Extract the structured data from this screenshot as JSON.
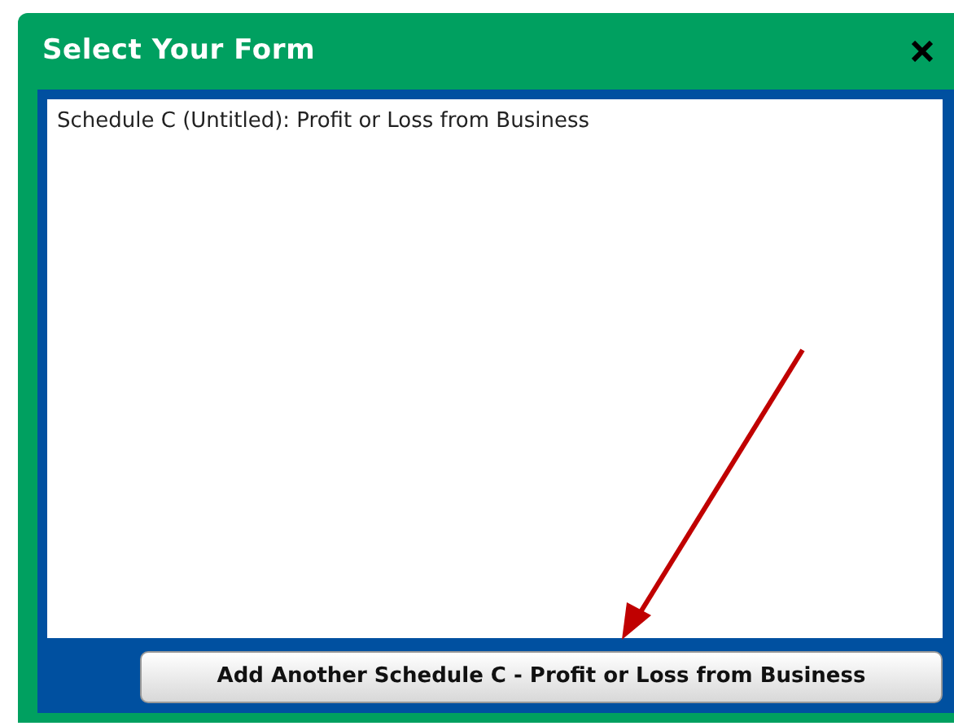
{
  "dialog": {
    "title": "Select Your Form"
  },
  "forms": [
    {
      "label": "Schedule C (Untitled): Profit or Loss from Business"
    }
  ],
  "add_button": {
    "label": "Add Another Schedule C - Profit or Loss from Business"
  }
}
